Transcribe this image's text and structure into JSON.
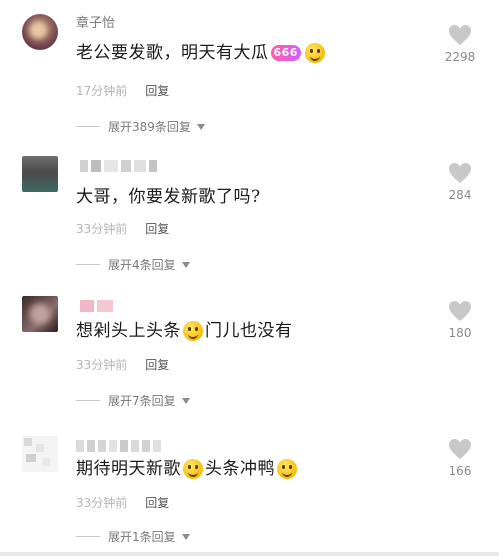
{
  "comments": [
    {
      "username": "章子怡",
      "text_before": "老公要发歌，明天有大瓜",
      "badge": "666",
      "text_after": "",
      "time": "17分钟前",
      "reply_label": "回复",
      "expand_label": "展开389条回复",
      "likes": "2298"
    },
    {
      "text_before": "大哥，你要发新歌了吗?",
      "time": "33分钟前",
      "reply_label": "回复",
      "expand_label": "展开4条回复",
      "likes": "284"
    },
    {
      "text_before": "想剁头上头条",
      "text_after": "门儿也没有",
      "time": "33分钟前",
      "reply_label": "回复",
      "expand_label": "展开7条回复",
      "likes": "180"
    },
    {
      "text_before": "期待明天新歌",
      "text_middle": "头条冲鸭",
      "time": "33分钟前",
      "reply_label": "回复",
      "expand_label": "展开1条回复",
      "likes": "166"
    }
  ]
}
